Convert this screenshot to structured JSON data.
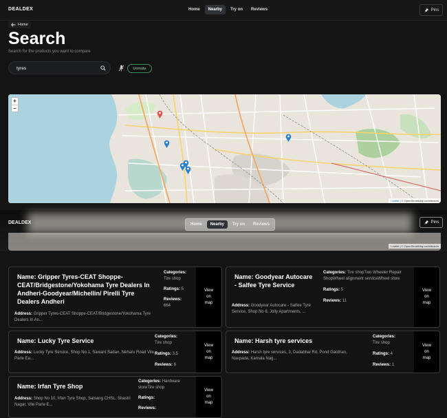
{
  "nav": {
    "brand": "DEALDEX",
    "links": [
      {
        "label": "Home",
        "active": false
      },
      {
        "label": "Nearby",
        "active": true
      },
      {
        "label": "Try on",
        "active": false
      },
      {
        "label": "Reviews",
        "active": false
      }
    ],
    "pins_label": "Pins",
    "pins_icon": "pin-icon"
  },
  "header": {
    "back_label": "Home",
    "back_icon": "arrow-left-icon",
    "title": "Search",
    "subtitle": "Search for the products you want to compare"
  },
  "search": {
    "value": "tyres",
    "placeholder": "",
    "search_icon": "search-icon",
    "mic_icon": "mic-off-icon",
    "unmute_label": "Unmute"
  },
  "map": {
    "zoom_in": "+",
    "zoom_out": "−",
    "attribution_leaflet": "Leaflet",
    "attribution_osm": "| © OpenStreetMap contributors",
    "marker_icon": "map-marker-icon"
  },
  "labels": {
    "name": "Name:",
    "address": "Address:",
    "categories": "Categories:",
    "ratings": "Ratings:",
    "reviews": "Reviews:",
    "view_line1": "View",
    "view_line2": "on",
    "view_line3": "map"
  },
  "results": [
    {
      "name": "Gripper Tyres-CEAT Shoppe-CEAT/Bridgestone/Yokohama Tyre Dealers In Andheri-Goodyear/Michellin/ Pirelli Tyre Dealers Andheri",
      "address": "Gripper Tyres-CEAT Shoppe-CEAT/Bridgestone/Yokohama Tyre Dealers In An...",
      "categories": "Tire shop",
      "ratings": "5",
      "reviews": "664"
    },
    {
      "name": "Goodyear Autocare - Salfee Tyre Service",
      "address": "Goodyear Autocare - Salfee Tyre Service, Shop No 6, Jolly Apartments, ...",
      "categories": "Tire shopTwo Wheeler Repair ShopWheel alignment serviceWheel store",
      "ratings": "5",
      "reviews": "11"
    },
    {
      "name": "Lucky Tyre Service",
      "address": "Lucky Tyre Service, Shop No.1, Sawant Sadan, Neharu Road Vile Parle Ea...",
      "categories": "Tire shop",
      "ratings": "3.5",
      "reviews": "6"
    },
    {
      "name": "Harsh tyre services",
      "address": "Harsh tyre services, 3, Dadabhai Rd, Pond Gaothan, Navpada, Kamala Nag...",
      "categories": "Tire shop",
      "ratings": "4",
      "reviews": "1"
    },
    {
      "name": "Irfan Tyre Shop",
      "address": "Shop No 10, Irfan Tyre Shop, Satsang CHSL, Shastri Nagar, Vile Parle E...",
      "categories": "Hardware storeTire shop",
      "ratings": "",
      "reviews": ""
    }
  ]
}
